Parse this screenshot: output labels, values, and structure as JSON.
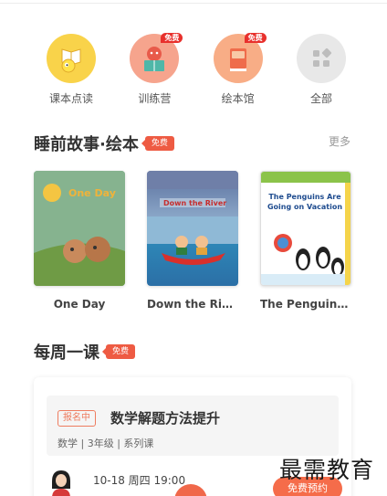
{
  "quick_nav": [
    {
      "label": "课本点读",
      "icon": "book-reading-icon",
      "badge": ""
    },
    {
      "label": "训练营",
      "icon": "camp-icon",
      "badge": "免费"
    },
    {
      "label": "绘本馆",
      "icon": "picture-book-icon",
      "badge": "免费"
    },
    {
      "label": "全部",
      "icon": "grid-icon",
      "badge": ""
    }
  ],
  "bedtime_section": {
    "title": "睡前故事·绘本",
    "badge": "免费",
    "more": "更多",
    "books": [
      {
        "title": "One Day",
        "cover_text": "One Day"
      },
      {
        "title": "Down the River",
        "cover_text": "Down the River"
      },
      {
        "title": "The Penguins ...",
        "cover_text": "The Penguins Are Going on Vacation"
      }
    ]
  },
  "weekly_section": {
    "title": "每周一课",
    "badge": "免费",
    "course": {
      "status": "报名中",
      "title": "数学解题方法提升",
      "meta": "数学 | 3年级 | 系列课",
      "time": "10-18 周四 19:00",
      "button": "免费预约"
    }
  },
  "watermark": "最需教育",
  "colors": {
    "accent": "#ee5b43",
    "button": "#f56c4a",
    "yellow_icon": "#f9d34a",
    "pink_icon": "#f6a48d",
    "gray_icon": "#e8e8e8"
  }
}
